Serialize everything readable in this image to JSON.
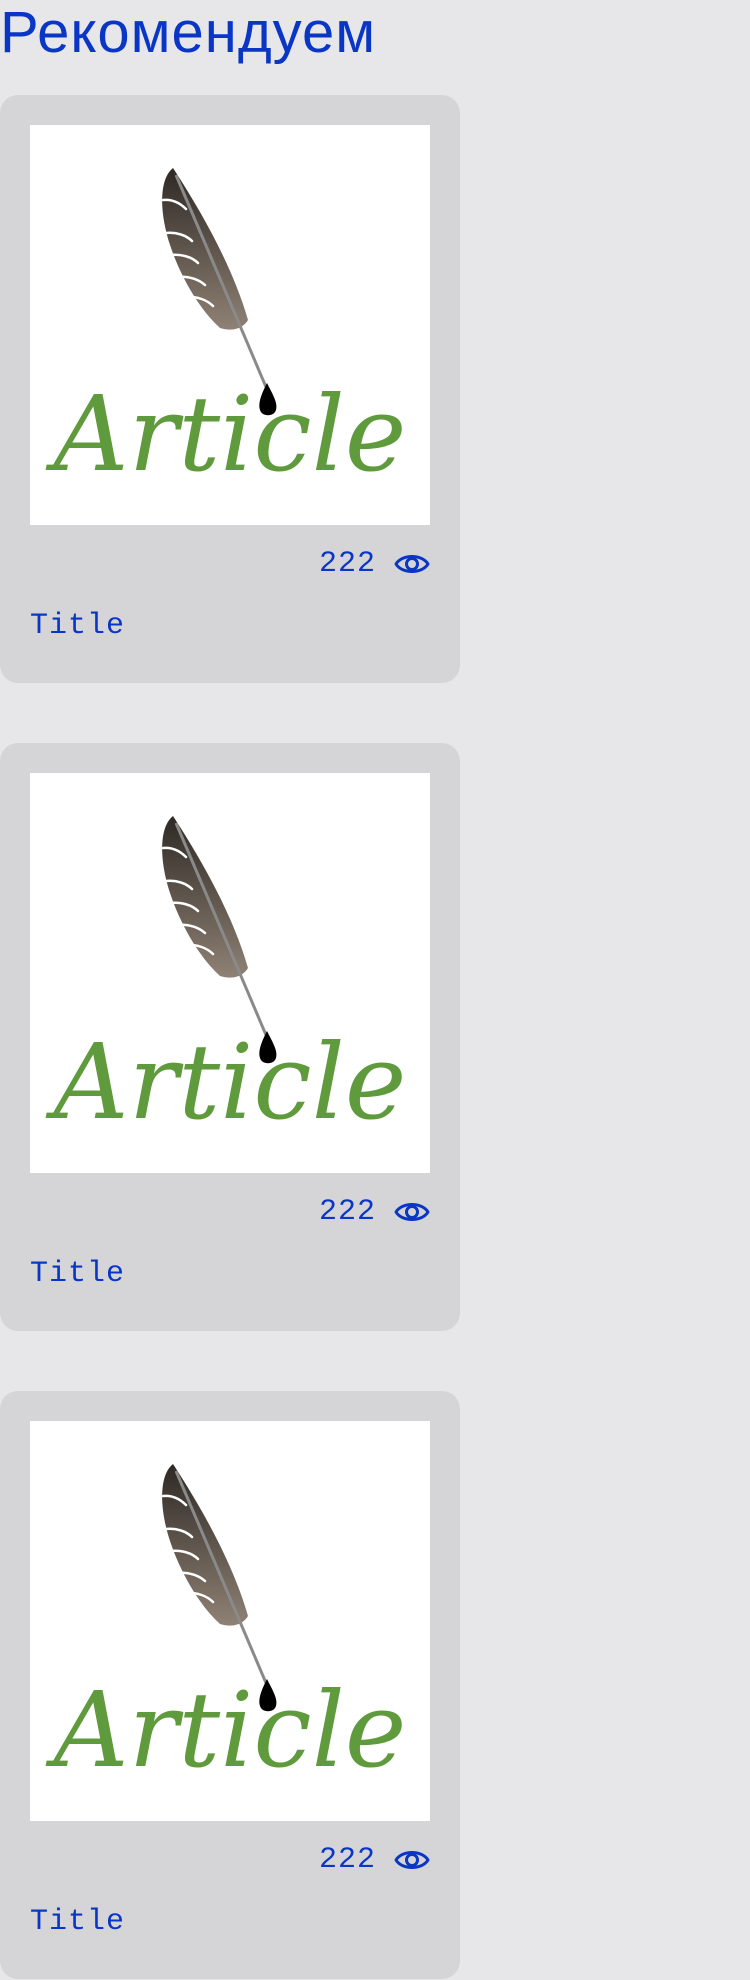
{
  "section": {
    "title": "Рекомендуем"
  },
  "articles": [
    {
      "image_text": "Article",
      "views": "222",
      "title": "Title"
    },
    {
      "image_text": "Article",
      "views": "222",
      "title": "Title"
    },
    {
      "image_text": "Article",
      "views": "222",
      "title": "Title"
    }
  ],
  "colors": {
    "accent": "#0a36c5",
    "page_bg": "#e7e7ea",
    "card_bg": "#d5d5d8",
    "logo_green": "#5f9a3c"
  },
  "icons": {
    "views": "eye-icon",
    "image": "feather-quill-logo"
  }
}
